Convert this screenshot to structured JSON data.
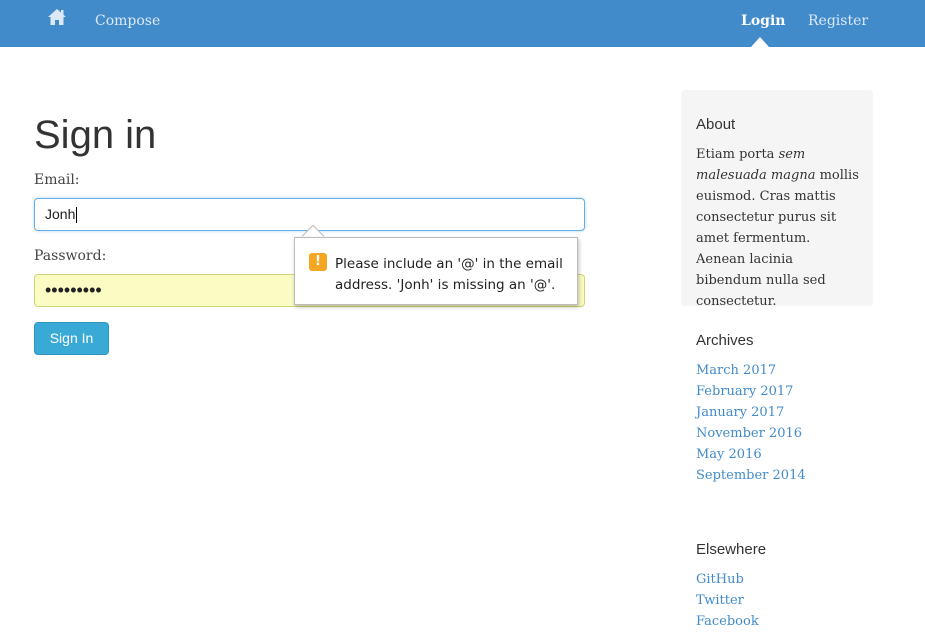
{
  "nav": {
    "home_icon": "home-icon",
    "compose": "Compose",
    "login": "Login",
    "register": "Register",
    "brand_color": "#428bca"
  },
  "main": {
    "title": "Sign in",
    "email_label": "Email:",
    "email_value": "Jonh",
    "password_label": "Password:",
    "password_value": "•••••••••",
    "submit_label": "Sign In"
  },
  "validation": {
    "icon": "warning-icon",
    "message": "Please include an '@' in the email address. 'Jonh' is missing an '@'."
  },
  "sidebar": {
    "about_heading": "About",
    "about_text_1": "Etiam porta ",
    "about_text_em": "sem malesuada magna",
    "about_text_2": " mollis euismod. Cras mattis consectetur purus sit amet fermentum. Aenean lacinia bibendum nulla sed consectetur.",
    "archives_heading": "Archives",
    "archives": [
      "March 2017",
      "February 2017",
      "January 2017",
      "November 2016",
      "May 2016",
      "September 2014"
    ],
    "elsewhere_heading": "Elsewhere",
    "elsewhere": [
      "GitHub",
      "Twitter",
      "Facebook"
    ]
  }
}
